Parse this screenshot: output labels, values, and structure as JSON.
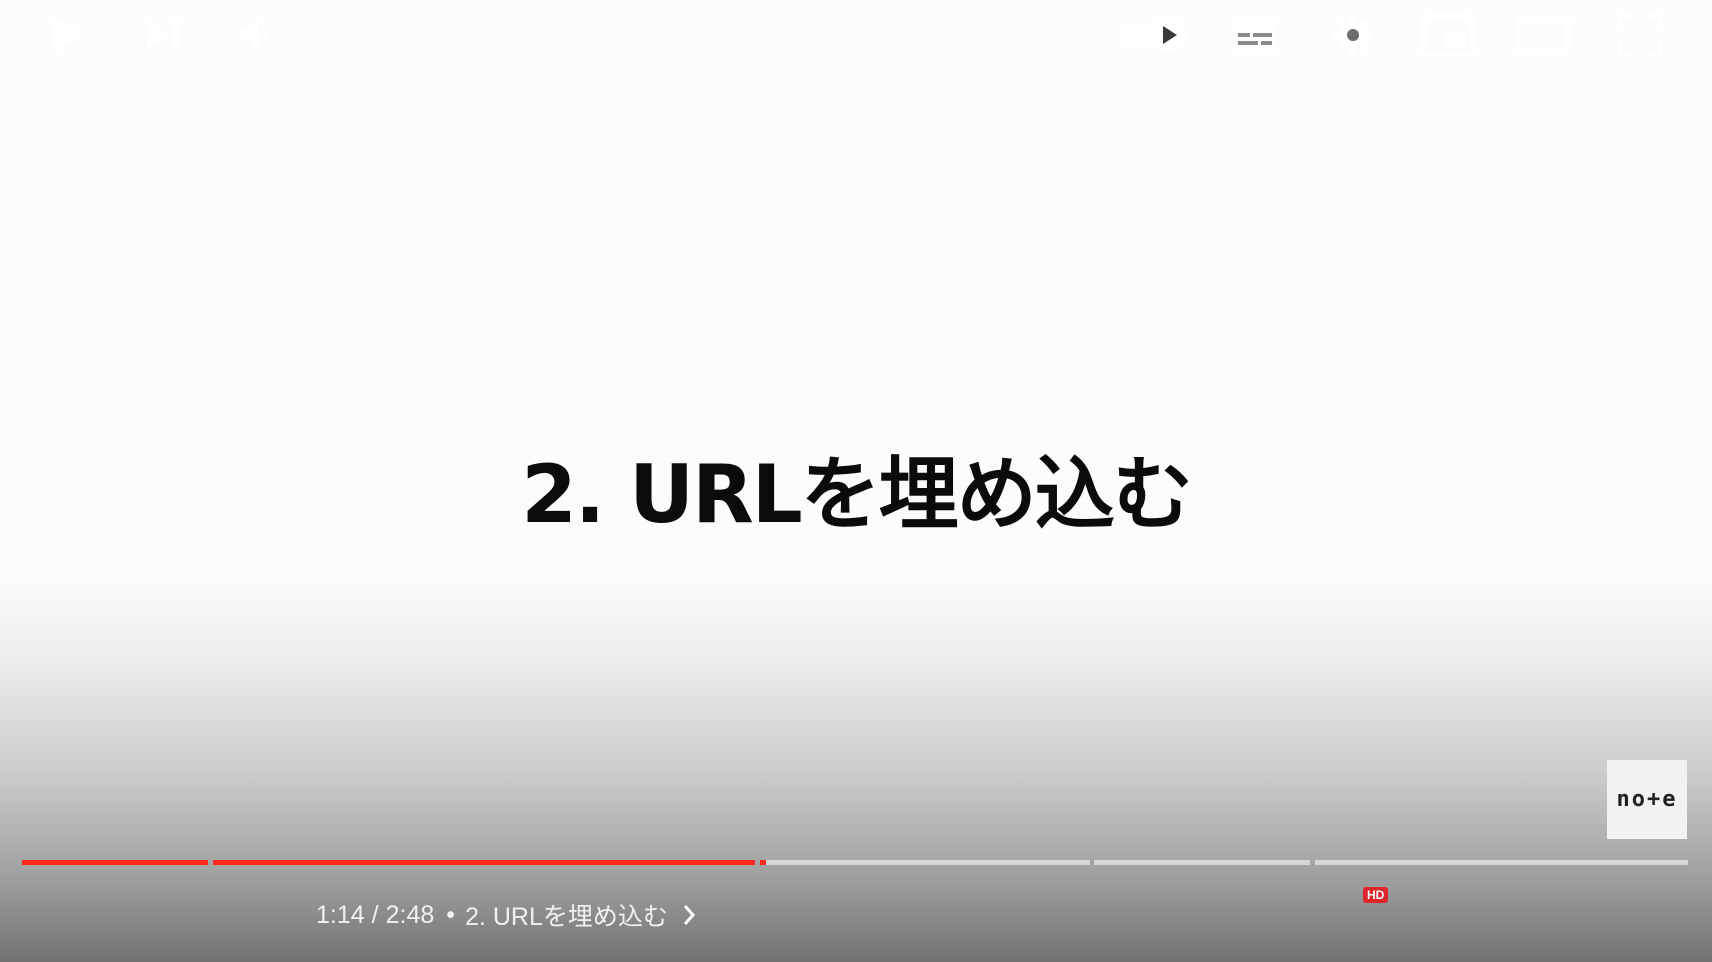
{
  "video": {
    "slide_title": "2. URLを埋め込む",
    "watermark_text": "no+e"
  },
  "progress": {
    "chapters": [
      {
        "fill": 1.0
      },
      {
        "fill": 1.0
      },
      {
        "fill": 1.0
      },
      {
        "fill": 0.0
      },
      {
        "fill": 0.0
      },
      {
        "fill": 0.0
      }
    ],
    "played_color": "#ff2a22"
  },
  "controls": {
    "current_time": "1:14",
    "separator": "/",
    "duration": "2:48",
    "chapter_dot": "•",
    "chapter_title": "2. URLを埋め込む",
    "hd_badge": "HD",
    "icons": {
      "play": "play-icon",
      "next": "next-icon",
      "volume": "volume-icon",
      "chapter_chevron": "chevron-right-icon",
      "autoplay": "autoplay-toggle-icon",
      "subtitles": "subtitles-icon",
      "settings": "settings-gear-icon",
      "miniplayer": "miniplayer-icon",
      "theater": "theater-mode-icon",
      "fullscreen": "fullscreen-icon"
    }
  }
}
